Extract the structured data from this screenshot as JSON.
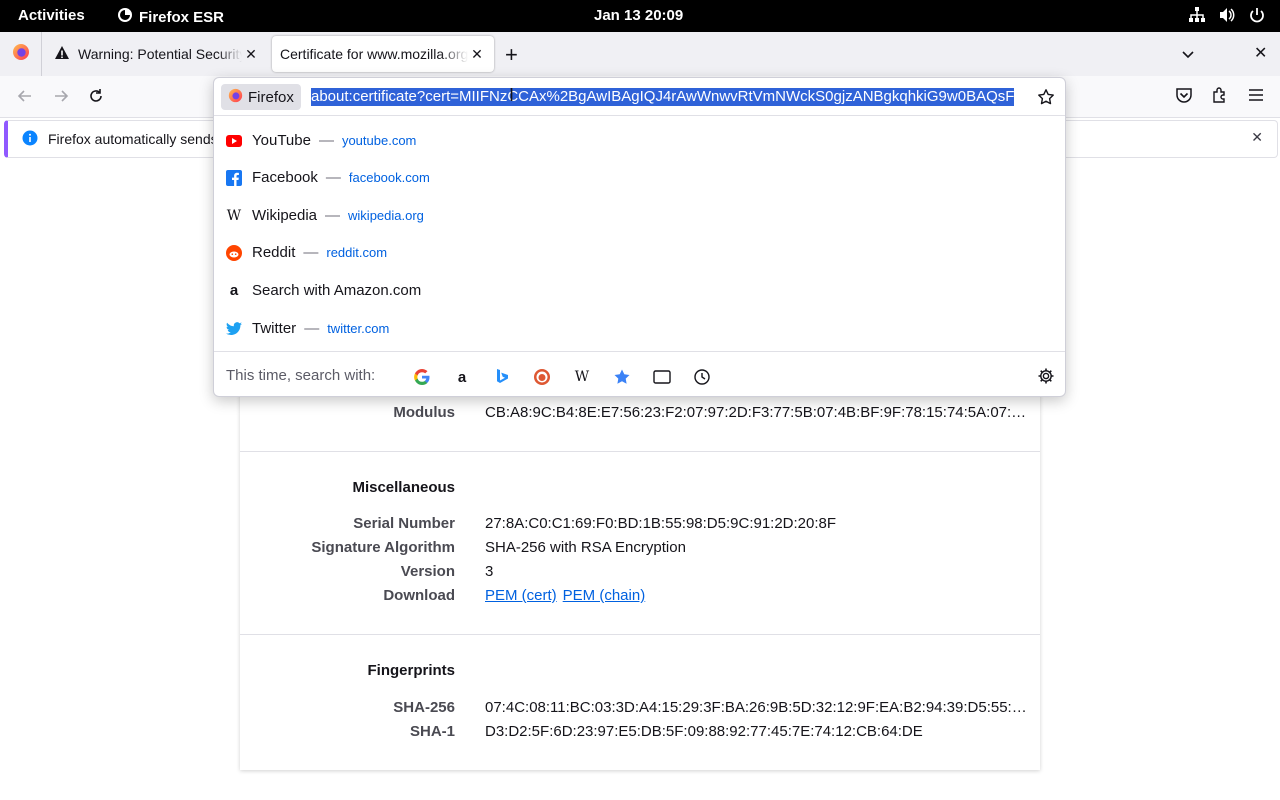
{
  "topbar": {
    "activities": "Activities",
    "app_name": "Firefox ESR",
    "clock": "Jan 13  20:09"
  },
  "tabs": [
    {
      "title": "Warning: Potential Security Risk Ahead",
      "icon": "warning-icon"
    },
    {
      "title": "Certificate for www.mozilla.org",
      "icon": "none",
      "active": true
    }
  ],
  "urlbar": {
    "engine_label": "Firefox",
    "url": "about:certificate?cert=MIIFNzCCAx%2BgAwIBAgIQJ4rAwWnwvRtVmNWckS0gjzANBgkqhkiG9w0BAQsF"
  },
  "notification": {
    "text": "Firefox automatically sends some data to Mozilla"
  },
  "suggestions": [
    {
      "name": "YouTube",
      "url": "youtube.com",
      "icon": "youtube-icon",
      "color": "#ff0000"
    },
    {
      "name": "Facebook",
      "url": "facebook.com",
      "icon": "facebook-icon",
      "color": "#1877f2"
    },
    {
      "name": "Wikipedia",
      "url": "wikipedia.org",
      "icon": "wikipedia-icon",
      "color": "#000000"
    },
    {
      "name": "Reddit",
      "url": "reddit.com",
      "icon": "reddit-icon",
      "color": "#ff4500"
    },
    {
      "name": "Search with Amazon.com",
      "url": "",
      "icon": "amazon-icon",
      "color": "#000000"
    },
    {
      "name": "Twitter",
      "url": "twitter.com",
      "icon": "twitter-icon",
      "color": "#1da1f2"
    }
  ],
  "search_with": {
    "label": "This time, search with:",
    "engines": [
      "google-icon",
      "amazon-icon",
      "bing-icon",
      "duckduckgo-icon",
      "wikipedia-icon",
      "bookmarks-icon",
      "tabs-icon",
      "history-icon"
    ]
  },
  "cert": {
    "modulus_label": "Modulus",
    "modulus_value": "CB:A8:9C:B4:8E:E7:56:23:F2:07:97:2D:F3:77:5B:07:4B:BF:9F:78:15:74:5A:07:…",
    "misc_title": "Miscellaneous",
    "serial_label": "Serial Number",
    "serial_value": "27:8A:C0:C1:69:F0:BD:1B:55:98:D5:9C:91:2D:20:8F",
    "sigalg_label": "Signature Algorithm",
    "sigalg_value": "SHA-256 with RSA Encryption",
    "version_label": "Version",
    "version_value": "3",
    "download_label": "Download",
    "pem_cert": "PEM (cert)",
    "pem_chain": "PEM (chain)",
    "fp_title": "Fingerprints",
    "sha256_label": "SHA-256",
    "sha256_value": "07:4C:08:11:BC:03:3D:A4:15:29:3F:BA:26:9B:5D:32:12:9F:EA:B2:94:39:D5:55:…",
    "sha1_label": "SHA-1",
    "sha1_value": "D3:D2:5F:6D:23:97:E5:DB:5F:09:88:92:77:45:7E:74:12:CB:64:DE"
  }
}
